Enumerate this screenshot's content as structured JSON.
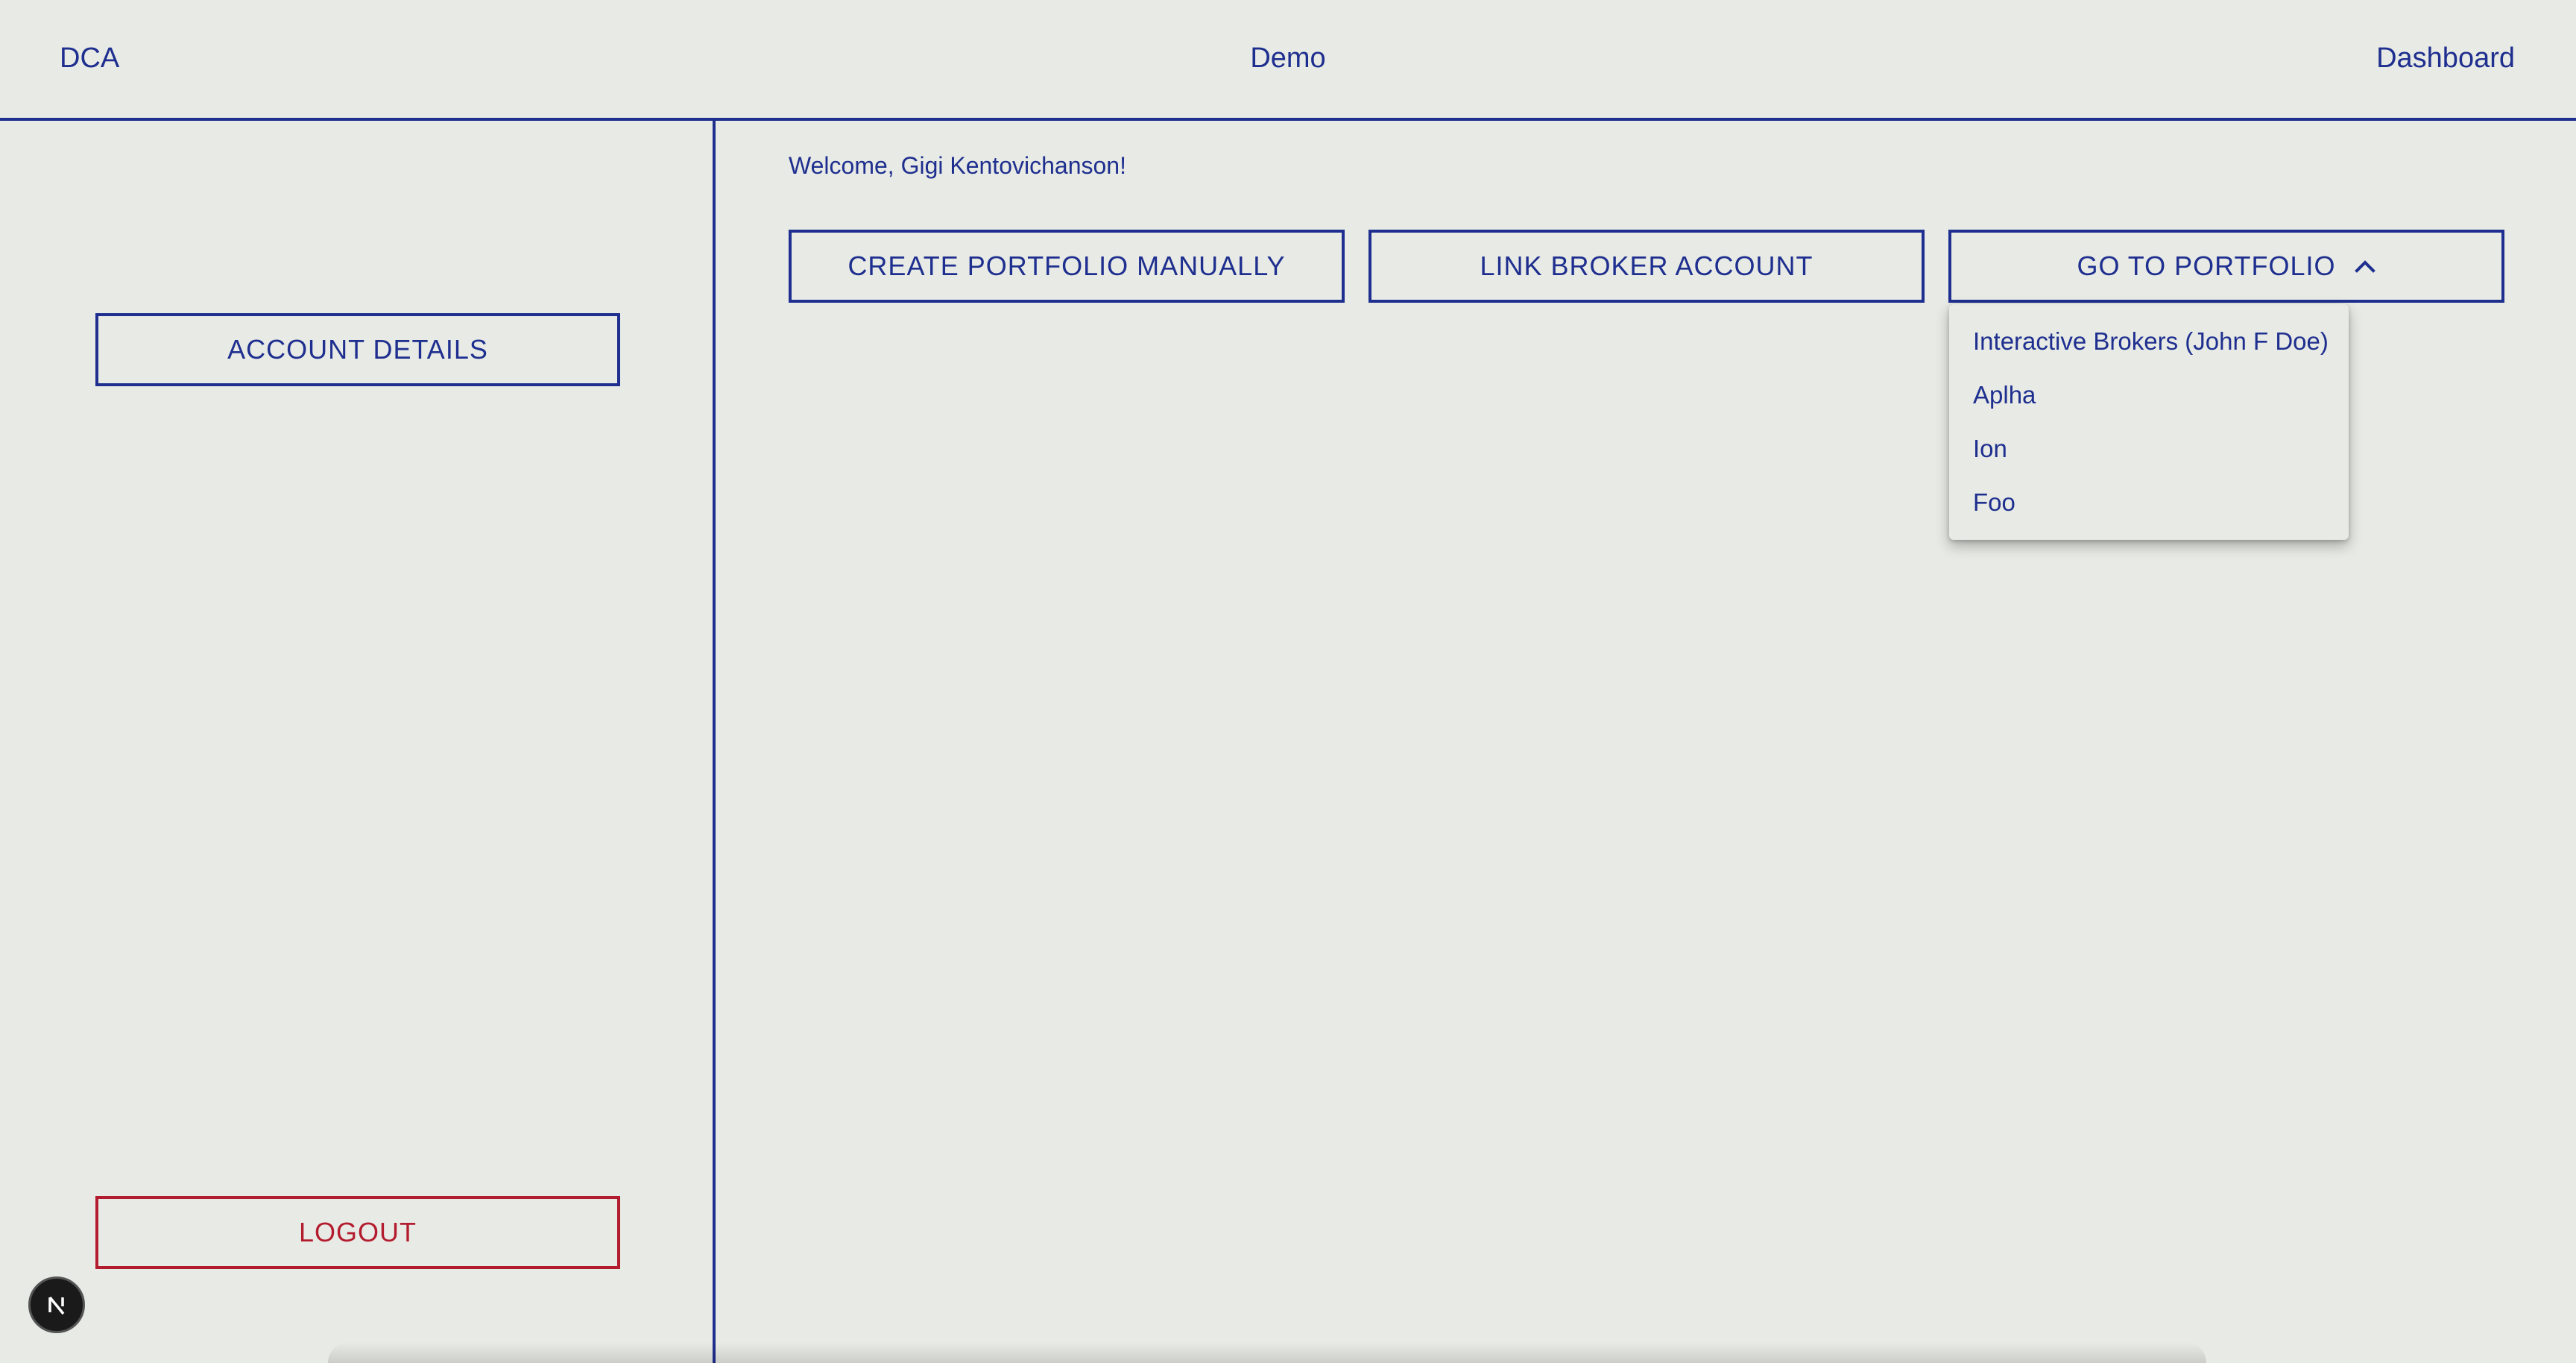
{
  "header": {
    "brand": "DCA",
    "title": "Demo",
    "nav_dashboard": "Dashboard"
  },
  "sidebar": {
    "account_details_label": "ACCOUNT DETAILS",
    "logout_label": "LOGOUT"
  },
  "main": {
    "welcome_text": "Welcome, Gigi Kentovichanson!",
    "actions": {
      "create_label": "CREATE PORTFOLIO MANUALLY",
      "link_label": "LINK BROKER ACCOUNT",
      "goto_label": "GO TO PORTFOLIO"
    },
    "portfolio_menu": {
      "items": [
        "Interactive Brokers (John F Doe)",
        "Aplha",
        "Ion",
        "Foo"
      ]
    }
  },
  "colors": {
    "accent": "#1e2f8f",
    "danger": "#b31b2e",
    "background": "#e8eae5"
  },
  "icons": {
    "goto_toggle": "chevron-up-icon",
    "dev_badge": "nextjs-logo-icon"
  }
}
